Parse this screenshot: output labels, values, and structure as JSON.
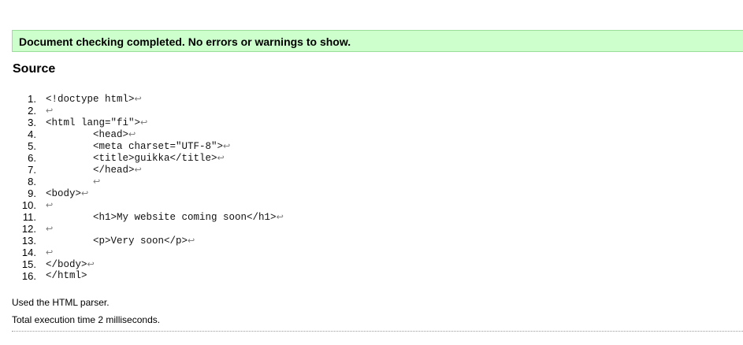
{
  "status": {
    "message": "Document checking completed. No errors or warnings to show.",
    "color": "#ccffcc"
  },
  "source": {
    "heading": "Source",
    "line_break_symbol": "↩",
    "lines": [
      {
        "num": "1.",
        "code": "<!doctype html>",
        "lb": "↩"
      },
      {
        "num": "2.",
        "code": "",
        "lb": "↩"
      },
      {
        "num": "3.",
        "code": "<html lang=\"fi\">",
        "lb": "↩"
      },
      {
        "num": "4.",
        "code": "        <head>",
        "lb": "↩"
      },
      {
        "num": "5.",
        "code": "        <meta charset=\"UTF-8\">",
        "lb": "↩"
      },
      {
        "num": "6.",
        "code": "        <title>guikka</title>",
        "lb": "↩"
      },
      {
        "num": "7.",
        "code": "        </head>",
        "lb": "↩"
      },
      {
        "num": "8.",
        "code": "        ",
        "lb": "↩"
      },
      {
        "num": "9.",
        "code": "<body>",
        "lb": "↩"
      },
      {
        "num": "10.",
        "code": "",
        "lb": "↩"
      },
      {
        "num": "11.",
        "code": "        <h1>My website coming soon</h1>",
        "lb": "↩"
      },
      {
        "num": "12.",
        "code": "",
        "lb": "↩"
      },
      {
        "num": "13.",
        "code": "        <p>Very soon</p>",
        "lb": "↩"
      },
      {
        "num": "14.",
        "code": "",
        "lb": "↩"
      },
      {
        "num": "15.",
        "code": "</body>",
        "lb": "↩"
      },
      {
        "num": "16.",
        "code": "</html>",
        "lb": ""
      }
    ]
  },
  "footer": {
    "parser": "Used the HTML parser.",
    "execution_time": "Total execution time 2 milliseconds."
  }
}
